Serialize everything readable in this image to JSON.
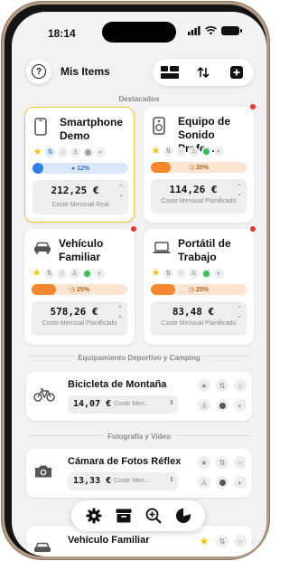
{
  "status": {
    "time": "18:14"
  },
  "header": {
    "title": "Mis Items",
    "help_icon": "?"
  },
  "sections": {
    "featured": "Destacados",
    "sports": "Equipamiento Deportivo y Camping",
    "photo": "Fotografía y Vídeo"
  },
  "featured_items": [
    {
      "name": "Smartphone Demo",
      "progress_text": "12%",
      "progress": 0.12,
      "cost": "212,25 €",
      "cost_label": "Coste Mensual Real",
      "icon": "smartphone-icon",
      "color": "#2f7fe6"
    },
    {
      "name": "Equipo de Sonido Profe...",
      "progress_text": "20%",
      "progress": 0.2,
      "cost": "114,26 €",
      "cost_label": "Coste Mensual Planificado",
      "icon": "speaker-icon",
      "color": "#f5882e"
    },
    {
      "name": "Vehículo Familiar",
      "progress_text": "25%",
      "progress": 0.25,
      "cost": "578,26 €",
      "cost_label": "Coste Mensual Planificado",
      "icon": "car-icon",
      "color": "#f5882e"
    },
    {
      "name": "Portátil de Trabajo",
      "progress_text": "25%",
      "progress": 0.25,
      "cost": "83,48 €",
      "cost_label": "Coste Mensual Planificado",
      "icon": "laptop-icon",
      "color": "#f5882e"
    }
  ],
  "list_items": [
    {
      "name": "Bicicleta de Montaña",
      "cost": "14,07 €",
      "cost_label": "Coste Men...",
      "icon": "bicycle-icon"
    },
    {
      "name": "Cámara de Fotos Réflex",
      "cost": "13,33 €",
      "cost_label": "Coste Men...",
      "icon": "camera-icon"
    },
    {
      "name": "Vehículo Familiar",
      "icon": "car-icon"
    }
  ],
  "colors": {
    "accent": "#f5c935",
    "alert": "#e9342f",
    "blue": "#2f7fe6",
    "orange": "#f5882e"
  }
}
